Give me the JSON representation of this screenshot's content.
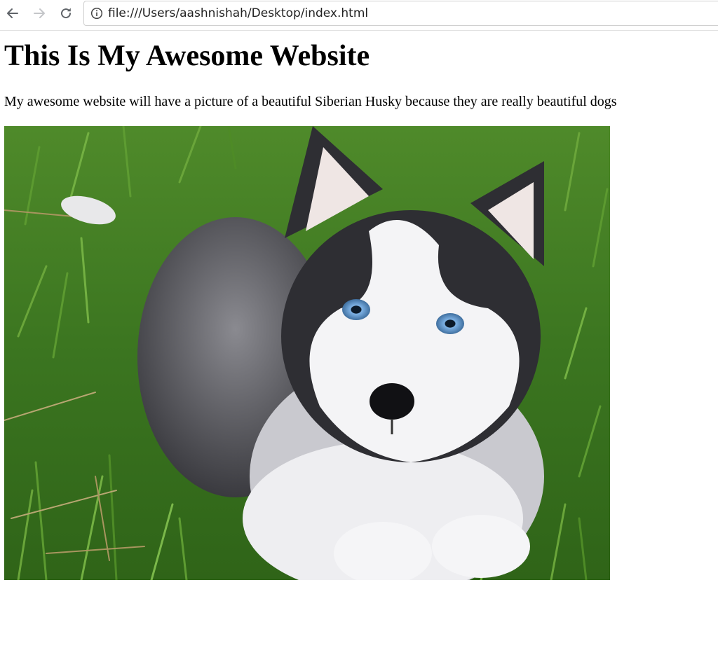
{
  "browser": {
    "url": "file:///Users/aashnishah/Desktop/index.html",
    "nav_icons": [
      "arrow-left-icon",
      "arrow-right-icon",
      "reload-icon",
      "info-icon"
    ]
  },
  "page": {
    "title": "This Is My Awesome Website",
    "paragraph": "My awesome website will have a picture of a beautiful Siberian Husky because they are really beautiful dogs",
    "image_subject": "siberian-husky-puppy-on-grass"
  },
  "colors": {
    "grass": "#3f7a22",
    "fur_dark": "#2b2b2e",
    "fur_light": "#f2f2f4",
    "eye_blue": "#6fa3d6"
  }
}
